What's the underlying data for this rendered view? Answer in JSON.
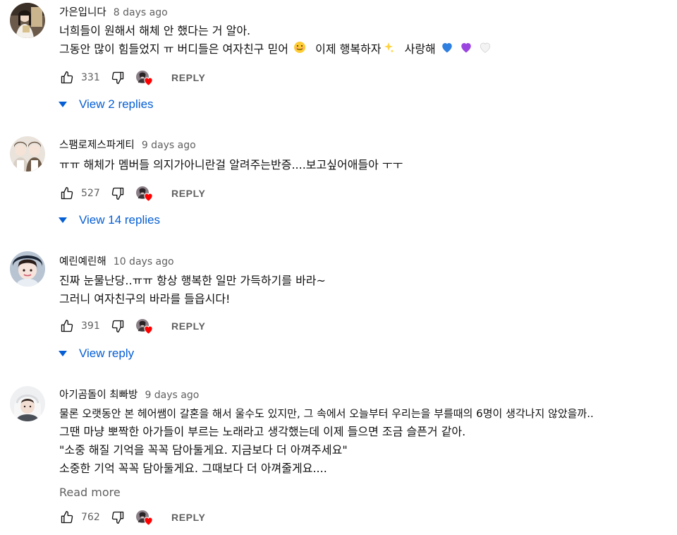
{
  "colors": {
    "link": "#065fd4",
    "secondary_text": "#606060",
    "heart": "#ff0000"
  },
  "reply_label": "REPLY",
  "comments": [
    {
      "author": "가은입니다",
      "time": "8 days ago",
      "lines": [
        "너희들이 원해서 해체 안 했다는 거 알아.",
        "그동안 많이 힘들었지 ㅠ 버디들은 여자친구 믿어"
      ],
      "line2_after_smile": "이제 행복하자",
      "line2_after_sparkle": "사랑해",
      "emojis": [
        "smile-emoji",
        "sparkles-emoji",
        "blue-heart-emoji",
        "purple-heart-emoji",
        "white-heart-emoji"
      ],
      "likes": "331",
      "replies_link": "View 2 replies"
    },
    {
      "author": "스팸로제스파게티",
      "time": "9 days ago",
      "lines": [
        "ㅠㅠ 해체가 멤버들 의지가아니란걸 알려주는반증....보고싶어애들아 ㅜㅜ"
      ],
      "likes": "527",
      "replies_link": "View 14 replies"
    },
    {
      "author": "예린예린해",
      "time": "10 days ago",
      "lines": [
        "진짜 눈물난당..ㅠㅠ 항상 행복한 일만 가득하기를 바라~",
        "그러니 여자친구의 바라를 들읍시다!"
      ],
      "likes": "391",
      "replies_link": "View reply"
    },
    {
      "author": "아기곰돌이 최빠방",
      "time": "9 days ago",
      "lines": [
        "물론 오랫동안 본 헤어쌤이 갈혼을 해서 울수도 있지만, 그 속에서 오늘부터 우리는을 부를때의 6명이 생각나지 않았을까..",
        "그땐 마냥 뽀짝한 아가들이 부르는 노래라고 생각했는데 이제 들으면 조금 슬픈거 같아.",
        "\"소중 해질 기억을 꼭꼭 담아둘게요. 지금보다 더 아껴주세요\"",
        "소중한 기억 꼭꼭 담아둘게요. 그때보다 더 아껴줄게요...."
      ],
      "read_more": "Read more",
      "likes": "762"
    }
  ]
}
